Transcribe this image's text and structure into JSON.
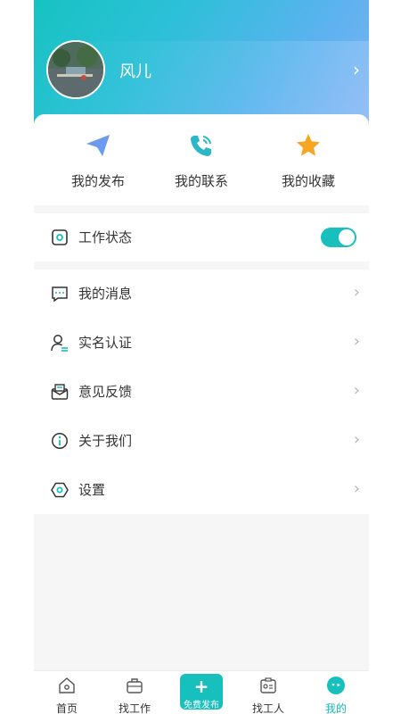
{
  "profile": {
    "name": "风儿"
  },
  "quick_actions": [
    {
      "label": "我的发布",
      "icon": "paper-plane-icon"
    },
    {
      "label": "我的联系",
      "icon": "phone-icon"
    },
    {
      "label": "我的收藏",
      "icon": "star-icon"
    }
  ],
  "work_status": {
    "label": "工作状态",
    "enabled": true
  },
  "menu": [
    {
      "label": "我的消息",
      "icon": "message-icon"
    },
    {
      "label": "实名认证",
      "icon": "user-verify-icon"
    },
    {
      "label": "意见反馈",
      "icon": "feedback-icon"
    },
    {
      "label": "关于我们",
      "icon": "info-icon"
    },
    {
      "label": "设置",
      "icon": "settings-icon"
    }
  ],
  "tabbar": {
    "items": [
      {
        "label": "首页",
        "icon": "home-icon"
      },
      {
        "label": "找工作",
        "icon": "briefcase-icon"
      },
      {
        "label": "找工人",
        "icon": "id-card-icon"
      },
      {
        "label": "我的",
        "icon": "profile-face-icon",
        "active": true
      }
    ],
    "publish_label": "免费发布"
  },
  "colors": {
    "accent": "#17c0bd",
    "star": "#f6a623",
    "plane": "#6b9af0"
  }
}
